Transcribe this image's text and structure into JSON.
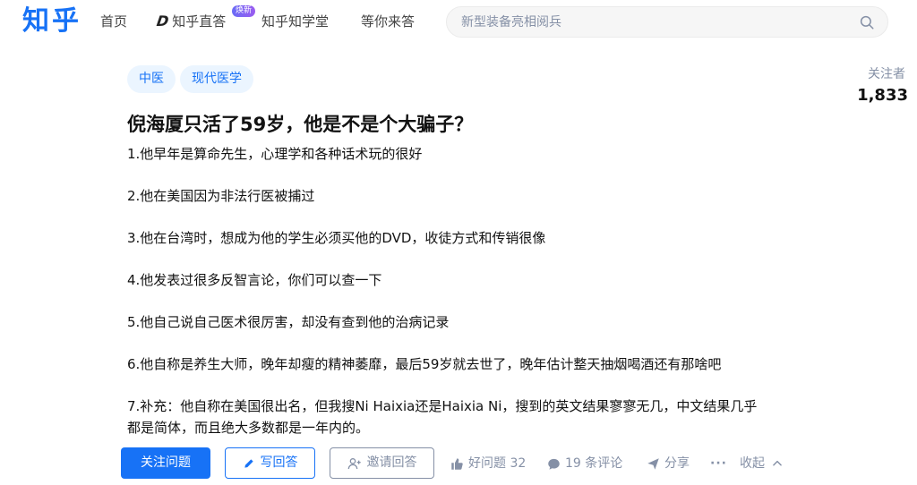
{
  "header": {
    "logo": "知乎",
    "nav": {
      "home": "首页",
      "zhida": "知乎直答",
      "zhida_badge": "焕新",
      "xuetang": "知乎知学堂",
      "waiting": "等你来答"
    },
    "search": {
      "placeholder": "新型装备亮相阅兵",
      "icon": "search-icon"
    }
  },
  "question": {
    "tags": [
      "中医",
      "现代医学"
    ],
    "followers_label": "关注者",
    "followers_count": "1,833",
    "title": "倪海厦只活了59岁，他是不是个大骗子？",
    "paragraphs": [
      "1.他早年是算命先生，心理学和各种话术玩的很好",
      "2.他在美国因为非法行医被捕过",
      "3.他在台湾时，想成为他的学生必须买他的DVD，收徒方式和传销很像",
      "4.他发表过很多反智言论，你们可以查一下",
      "5.他自己说自己医术很厉害，却没有查到他的治病记录",
      "6.他自称是养生大师，晚年却瘦的精神萎靡，最后59岁就去世了，晚年估计整天抽烟喝酒还有那啥吧",
      "7.补充：他自称在美国很出名，但我搜Ni Haixia还是Haixia Ni，搜到的英文结果寥寥无几，中文结果几乎都是简体，而且绝大多数都是一年内的。"
    ]
  },
  "actions": {
    "follow": "关注问题",
    "write": "写回答",
    "invite": "邀请回答",
    "good_question": "好问题 32",
    "comments": "19 条评论",
    "share": "分享",
    "more": "···",
    "collapse": "收起"
  },
  "colors": {
    "brand": "#1772f6",
    "muted": "#8590a6",
    "tag_bg": "#ebf5ff"
  }
}
